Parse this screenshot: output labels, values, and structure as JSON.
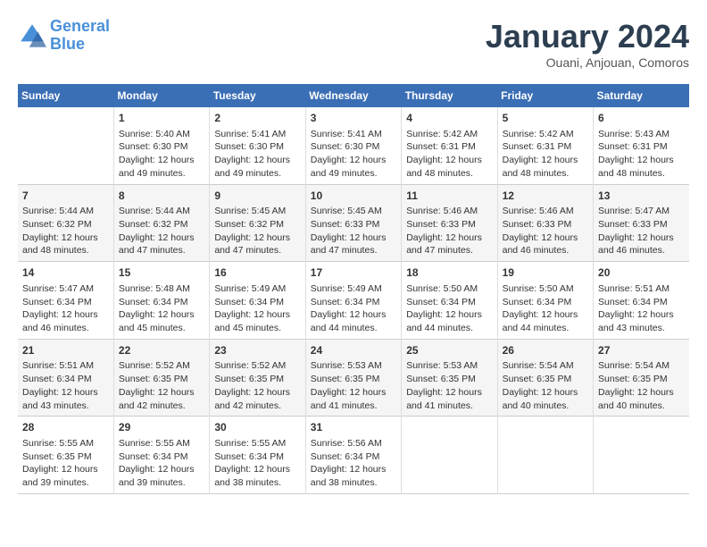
{
  "header": {
    "logo_line1": "General",
    "logo_line2": "Blue",
    "month": "January 2024",
    "location": "Ouani, Anjouan, Comoros"
  },
  "days_of_week": [
    "Sunday",
    "Monday",
    "Tuesday",
    "Wednesday",
    "Thursday",
    "Friday",
    "Saturday"
  ],
  "weeks": [
    [
      {
        "day": "",
        "info": ""
      },
      {
        "day": "1",
        "info": "Sunrise: 5:40 AM\nSunset: 6:30 PM\nDaylight: 12 hours\nand 49 minutes."
      },
      {
        "day": "2",
        "info": "Sunrise: 5:41 AM\nSunset: 6:30 PM\nDaylight: 12 hours\nand 49 minutes."
      },
      {
        "day": "3",
        "info": "Sunrise: 5:41 AM\nSunset: 6:30 PM\nDaylight: 12 hours\nand 49 minutes."
      },
      {
        "day": "4",
        "info": "Sunrise: 5:42 AM\nSunset: 6:31 PM\nDaylight: 12 hours\nand 48 minutes."
      },
      {
        "day": "5",
        "info": "Sunrise: 5:42 AM\nSunset: 6:31 PM\nDaylight: 12 hours\nand 48 minutes."
      },
      {
        "day": "6",
        "info": "Sunrise: 5:43 AM\nSunset: 6:31 PM\nDaylight: 12 hours\nand 48 minutes."
      }
    ],
    [
      {
        "day": "7",
        "info": "Sunrise: 5:44 AM\nSunset: 6:32 PM\nDaylight: 12 hours\nand 48 minutes."
      },
      {
        "day": "8",
        "info": "Sunrise: 5:44 AM\nSunset: 6:32 PM\nDaylight: 12 hours\nand 47 minutes."
      },
      {
        "day": "9",
        "info": "Sunrise: 5:45 AM\nSunset: 6:32 PM\nDaylight: 12 hours\nand 47 minutes."
      },
      {
        "day": "10",
        "info": "Sunrise: 5:45 AM\nSunset: 6:33 PM\nDaylight: 12 hours\nand 47 minutes."
      },
      {
        "day": "11",
        "info": "Sunrise: 5:46 AM\nSunset: 6:33 PM\nDaylight: 12 hours\nand 47 minutes."
      },
      {
        "day": "12",
        "info": "Sunrise: 5:46 AM\nSunset: 6:33 PM\nDaylight: 12 hours\nand 46 minutes."
      },
      {
        "day": "13",
        "info": "Sunrise: 5:47 AM\nSunset: 6:33 PM\nDaylight: 12 hours\nand 46 minutes."
      }
    ],
    [
      {
        "day": "14",
        "info": "Sunrise: 5:47 AM\nSunset: 6:34 PM\nDaylight: 12 hours\nand 46 minutes."
      },
      {
        "day": "15",
        "info": "Sunrise: 5:48 AM\nSunset: 6:34 PM\nDaylight: 12 hours\nand 45 minutes."
      },
      {
        "day": "16",
        "info": "Sunrise: 5:49 AM\nSunset: 6:34 PM\nDaylight: 12 hours\nand 45 minutes."
      },
      {
        "day": "17",
        "info": "Sunrise: 5:49 AM\nSunset: 6:34 PM\nDaylight: 12 hours\nand 44 minutes."
      },
      {
        "day": "18",
        "info": "Sunrise: 5:50 AM\nSunset: 6:34 PM\nDaylight: 12 hours\nand 44 minutes."
      },
      {
        "day": "19",
        "info": "Sunrise: 5:50 AM\nSunset: 6:34 PM\nDaylight: 12 hours\nand 44 minutes."
      },
      {
        "day": "20",
        "info": "Sunrise: 5:51 AM\nSunset: 6:34 PM\nDaylight: 12 hours\nand 43 minutes."
      }
    ],
    [
      {
        "day": "21",
        "info": "Sunrise: 5:51 AM\nSunset: 6:34 PM\nDaylight: 12 hours\nand 43 minutes."
      },
      {
        "day": "22",
        "info": "Sunrise: 5:52 AM\nSunset: 6:35 PM\nDaylight: 12 hours\nand 42 minutes."
      },
      {
        "day": "23",
        "info": "Sunrise: 5:52 AM\nSunset: 6:35 PM\nDaylight: 12 hours\nand 42 minutes."
      },
      {
        "day": "24",
        "info": "Sunrise: 5:53 AM\nSunset: 6:35 PM\nDaylight: 12 hours\nand 41 minutes."
      },
      {
        "day": "25",
        "info": "Sunrise: 5:53 AM\nSunset: 6:35 PM\nDaylight: 12 hours\nand 41 minutes."
      },
      {
        "day": "26",
        "info": "Sunrise: 5:54 AM\nSunset: 6:35 PM\nDaylight: 12 hours\nand 40 minutes."
      },
      {
        "day": "27",
        "info": "Sunrise: 5:54 AM\nSunset: 6:35 PM\nDaylight: 12 hours\nand 40 minutes."
      }
    ],
    [
      {
        "day": "28",
        "info": "Sunrise: 5:55 AM\nSunset: 6:35 PM\nDaylight: 12 hours\nand 39 minutes."
      },
      {
        "day": "29",
        "info": "Sunrise: 5:55 AM\nSunset: 6:34 PM\nDaylight: 12 hours\nand 39 minutes."
      },
      {
        "day": "30",
        "info": "Sunrise: 5:55 AM\nSunset: 6:34 PM\nDaylight: 12 hours\nand 38 minutes."
      },
      {
        "day": "31",
        "info": "Sunrise: 5:56 AM\nSunset: 6:34 PM\nDaylight: 12 hours\nand 38 minutes."
      },
      {
        "day": "",
        "info": ""
      },
      {
        "day": "",
        "info": ""
      },
      {
        "day": "",
        "info": ""
      }
    ]
  ]
}
